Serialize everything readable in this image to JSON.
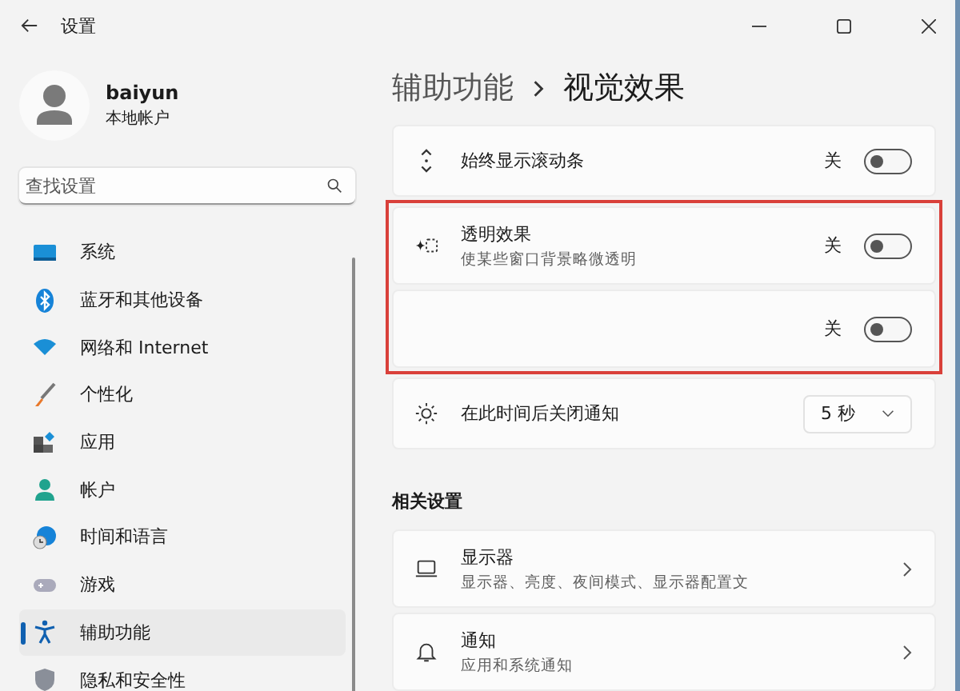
{
  "window": {
    "title": "设置"
  },
  "account": {
    "name": "baiyun",
    "type": "本地帐户"
  },
  "search": {
    "placeholder": "查找设置"
  },
  "sidebar": {
    "items": [
      {
        "label": "系统",
        "selected": false
      },
      {
        "label": "蓝牙和其他设备",
        "selected": false
      },
      {
        "label": "网络和 Internet",
        "selected": false
      },
      {
        "label": "个性化",
        "selected": false
      },
      {
        "label": "应用",
        "selected": false
      },
      {
        "label": "帐户",
        "selected": false
      },
      {
        "label": "时间和语言",
        "selected": false
      },
      {
        "label": "游戏",
        "selected": false
      },
      {
        "label": "辅助功能",
        "selected": true
      },
      {
        "label": "隐私和安全性",
        "selected": false
      }
    ]
  },
  "breadcrumb": [
    "辅助功能",
    "视觉效果"
  ],
  "settings": [
    {
      "kind": "toggle",
      "title": "始终显示滚动条",
      "state_label": "关",
      "on": false,
      "highlighted": false
    },
    {
      "kind": "toggle",
      "title": "透明效果",
      "subtitle": "使某些窗口背景略微透明",
      "state_label": "关",
      "on": false,
      "highlighted": true
    },
    {
      "kind": "toggle",
      "state_label": "关",
      "on": false,
      "highlighted": true
    },
    {
      "kind": "dropdown",
      "title": "在此时间后关闭通知",
      "value": "5 秒",
      "highlighted": false
    }
  ],
  "related": {
    "heading": "相关设置",
    "items": [
      {
        "title": "显示器",
        "subtitle": "显示器、亮度、夜间模式、显示器配置文"
      },
      {
        "title": "通知",
        "subtitle": "应用和系统通知"
      }
    ]
  }
}
